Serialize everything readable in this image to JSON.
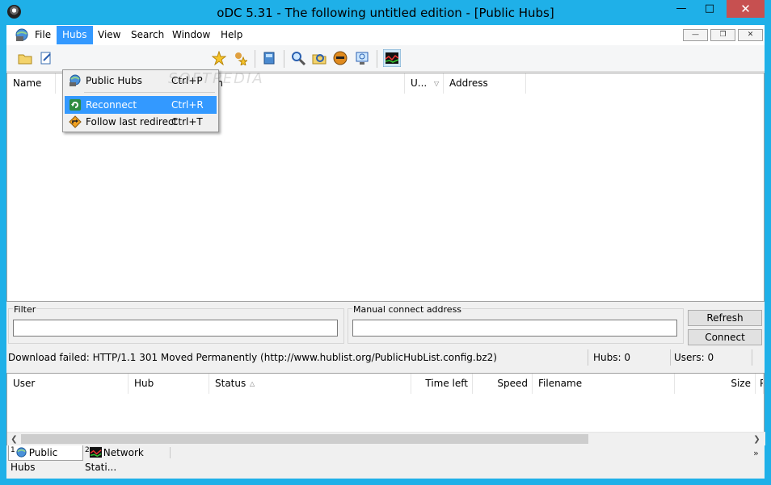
{
  "window": {
    "title": "oDC 5.31 - The following untitled edition - [Public Hubs]"
  },
  "menu": [
    {
      "label": "File"
    },
    {
      "label": "Hubs"
    },
    {
      "label": "View"
    },
    {
      "label": "Search"
    },
    {
      "label": "Window"
    },
    {
      "label": "Help"
    }
  ],
  "hubs_menu": [
    {
      "label": "Public Hubs",
      "shortcut": "Ctrl+P",
      "icon": "globe-network-icon"
    },
    {
      "label": "Reconnect",
      "shortcut": "Ctrl+R",
      "icon": "refresh-icon"
    },
    {
      "label": "Follow last redirect",
      "shortcut": "Ctrl+T",
      "icon": "redirect-arrow-icon"
    }
  ],
  "hub_columns": [
    "Name",
    "on",
    "U...",
    "Address"
  ],
  "filter": {
    "label": "Filter",
    "value": ""
  },
  "manual": {
    "label": "Manual connect address",
    "value": ""
  },
  "buttons": {
    "refresh": "Refresh",
    "connect": "Connect"
  },
  "status": {
    "message": "Download failed: HTTP/1.1 301 Moved Permanently  (http://www.hublist.org/PublicHubList.config.bz2)",
    "hubs": "Hubs: 0",
    "users": "Users: 0"
  },
  "transfer_columns": [
    "User",
    "Hub",
    "Status",
    "Time left",
    "Speed",
    "Filename",
    "Size",
    "P"
  ],
  "tabs": [
    {
      "num": "1",
      "label": "Public Hubs"
    },
    {
      "num": "2",
      "label": "Network Stati..."
    }
  ],
  "watermark": "SOFTPEDIA",
  "colors": {
    "titlebar": "#1fb0e8",
    "highlight": "#3399ff",
    "close": "#c75050"
  }
}
